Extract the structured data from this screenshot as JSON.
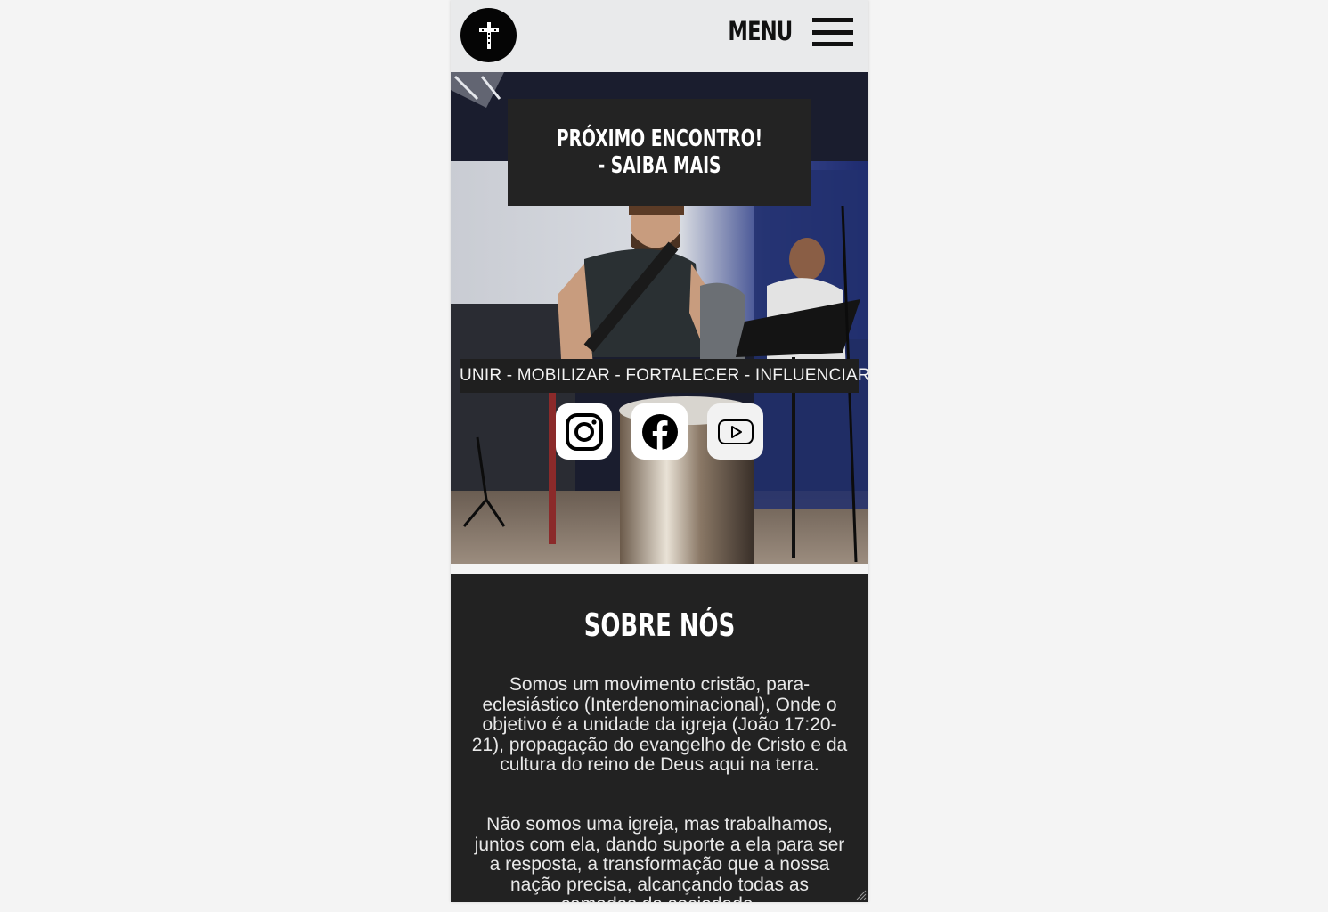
{
  "header": {
    "logo_icon": "cross-icon",
    "menu_label": "MENU",
    "menu_icon": "hamburger-icon"
  },
  "hero": {
    "cta_label": "PRÓXIMO ENCONTRO! - SAIBA MAIS",
    "tagline": "UNIR - MOBILIZAR - FORTALECER - INFLUENCIAR",
    "socials": [
      {
        "icon": "instagram-icon"
      },
      {
        "icon": "facebook-icon"
      },
      {
        "icon": "youtube-icon"
      }
    ]
  },
  "about": {
    "title": "SOBRE NÓS",
    "paragraph1": "Somos um movimento cristão, para-eclesiástico (Interdenominacional), Onde o objetivo é a unidade da igreja (João 17:20-21), propagação do evangelho de Cristo e da cultura do reino de Deus aqui na terra.",
    "paragraph2": "Não somos uma igreja, mas trabalhamos, juntos com ela, dando suporte a ela para ser a resposta, a transformação que a nossa nação precisa, alcançando todas as camadas da sociedade."
  },
  "colors": {
    "header_bg": "#e9eaeb",
    "dark_panel": "#222222",
    "text_light": "#ffffff"
  }
}
